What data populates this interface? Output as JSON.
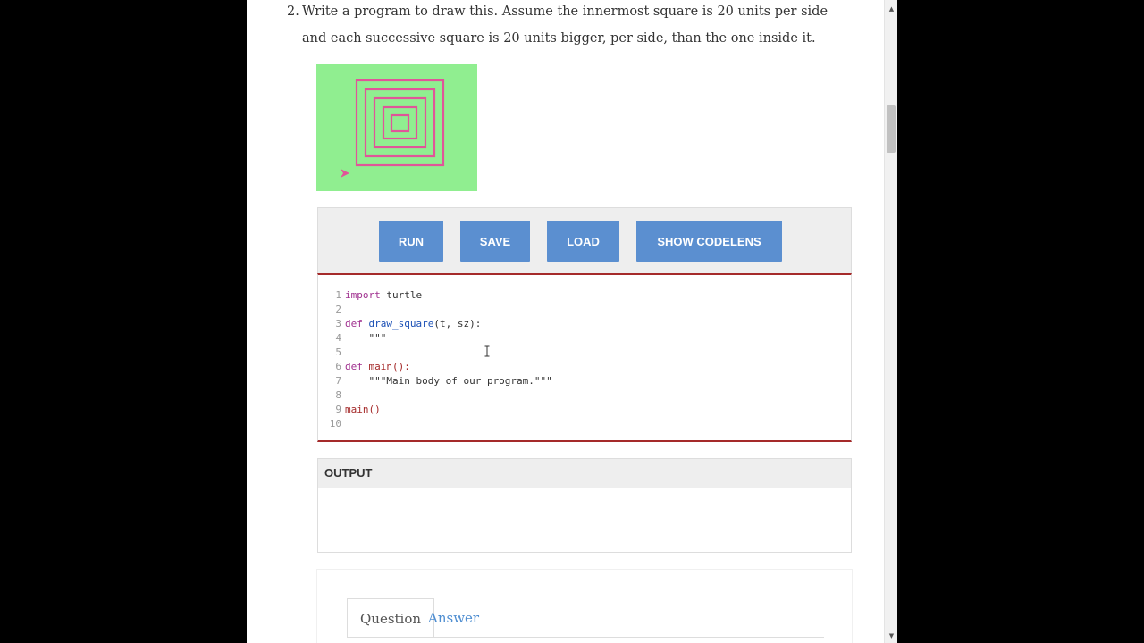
{
  "question": {
    "number": "2.",
    "line1": "Write a program to draw this. Assume the innermost square is 20 units per side",
    "line2": "and each successive square is 20 units bigger, per side, than the one inside it."
  },
  "colors": {
    "canvas_bg": "#90ee90",
    "square_stroke": "#e05599",
    "button_bg": "#5b8fd0",
    "editor_border": "#a52a2a"
  },
  "toolbar": {
    "run_label": "RUN",
    "save_label": "SAVE",
    "load_label": "LOAD",
    "codelens_label": "SHOW CODELENS"
  },
  "code": {
    "lines": [
      {
        "n": "1",
        "parts": [
          {
            "t": "import",
            "c": "kw"
          },
          {
            "t": " turtle",
            "c": ""
          }
        ]
      },
      {
        "n": "2",
        "parts": []
      },
      {
        "n": "3",
        "parts": [
          {
            "t": "def",
            "c": "kw"
          },
          {
            "t": " ",
            "c": ""
          },
          {
            "t": "draw_square",
            "c": "fn"
          },
          {
            "t": "(t, sz):",
            "c": ""
          }
        ]
      },
      {
        "n": "4",
        "parts": [
          {
            "t": "    \"\"\"",
            "c": ""
          }
        ]
      },
      {
        "n": "5",
        "parts": []
      },
      {
        "n": "6",
        "parts": [
          {
            "t": "def",
            "c": "kw"
          },
          {
            "t": " ",
            "c": ""
          },
          {
            "t": "main",
            "c": "br"
          },
          {
            "t": "():",
            "c": "br"
          }
        ]
      },
      {
        "n": "7",
        "parts": [
          {
            "t": "    \"\"\"Main body of our program.\"\"\"",
            "c": ""
          }
        ]
      },
      {
        "n": "8",
        "parts": []
      },
      {
        "n": "9",
        "parts": [
          {
            "t": "main()",
            "c": "br"
          }
        ]
      },
      {
        "n": "10",
        "parts": []
      }
    ]
  },
  "output": {
    "heading": "OUTPUT",
    "value": ""
  },
  "tabs": {
    "question": "Question",
    "answer": "Answer"
  },
  "scrollbar": {
    "up_arrow": "▲",
    "down_arrow": "▼"
  }
}
